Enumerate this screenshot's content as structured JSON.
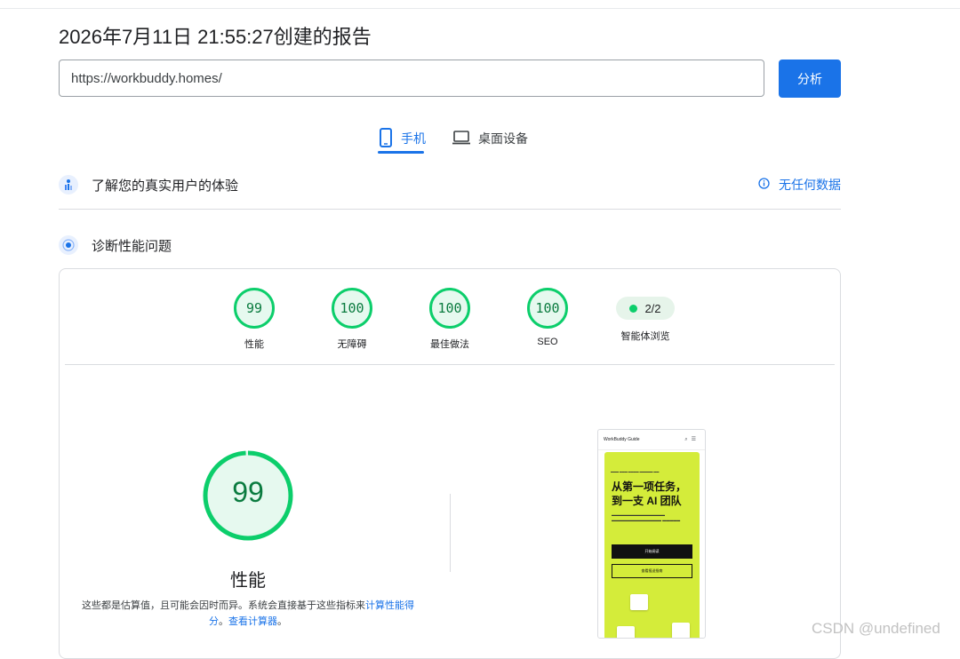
{
  "report": {
    "title": "2026年7月11日 21:55:27创建的报告"
  },
  "url_bar": {
    "value": "https://workbuddy.homes/",
    "button_label": "分析"
  },
  "device_tabs": [
    {
      "label": "手机",
      "icon": "smartphone-icon",
      "active": true
    },
    {
      "label": "桌面设备",
      "icon": "laptop-icon",
      "active": false
    }
  ],
  "field_data": {
    "title": "了解您的真实用户的体验",
    "no_data_label": "无任何数据"
  },
  "lab_data": {
    "title": "诊断性能问题"
  },
  "category_scores": [
    {
      "score": "99",
      "label": "性能"
    },
    {
      "score": "100",
      "label": "无障碍"
    },
    {
      "score": "100",
      "label": "最佳做法"
    },
    {
      "score": "100",
      "label": "SEO"
    }
  ],
  "agent": {
    "value": "2/2",
    "label": "智能体浏览"
  },
  "performance": {
    "score": "99",
    "score_fraction": 0.99,
    "label": "性能",
    "note_text": "这些都是估算值，且可能会因时而异。系统会直接基于这些指标来",
    "note_link1": "计算性能得分",
    "note_sep": "。",
    "note_link2": "查看计算器",
    "note_end": "。"
  },
  "screenshot": {
    "site_title": "WorkBuddy Guide",
    "headline1": "从第一项任务，",
    "headline2": "到一支 AI 团队",
    "button_primary": "开始阅读",
    "button_secondary": "查看报送指南"
  },
  "colors": {
    "accent": "#1a73e8",
    "pass": "#0cce6b",
    "pass_text": "#0a7b3f",
    "screenshot_bg": "#d4ec3a"
  },
  "watermark": "CSDN @undefined"
}
